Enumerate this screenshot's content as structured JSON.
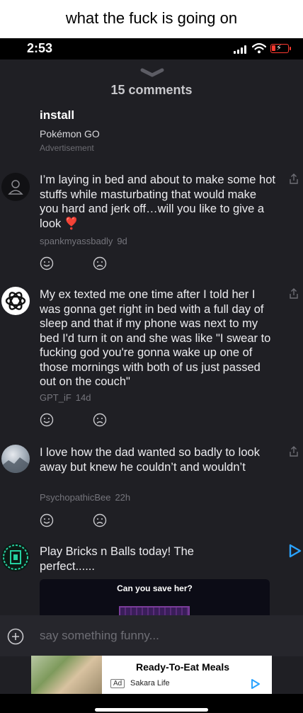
{
  "caption": "what the fuck is going on",
  "status_bar": {
    "time": "2:53",
    "battery_color": "#ff3b30"
  },
  "sheet": {
    "title": "15 comments"
  },
  "sponsored": {
    "title": "install",
    "subtitle": "Pokémon GO",
    "tag": "Advertisement"
  },
  "comments": [
    {
      "text": "I’m laying in bed and about to make some hot stuffs while masturbating that would make you hard and jerk off…will you like to give a look ❣️",
      "user": "spankmyassbadly",
      "age": "9d",
      "avatar_icon": "default-user-icon"
    },
    {
      "text": "My ex texted me one time after I told her I was gonna get right in bed with a full day of sleep and that if my phone was next to my bed I'd turn it on and she was like \"I swear to fucking god you're gonna wake up one of those mornings with both of us just passed out on the couch\"",
      "user": "GPT_iF",
      "age": "14d",
      "avatar_icon": "openai-logo-icon"
    },
    {
      "text": "I love how the dad wanted so badly to look away but knew he couldn’t and wouldn’t",
      "user": "PsychopathicBee",
      "age": "22h",
      "avatar_icon": "photo-avatar"
    }
  ],
  "ad_comment": {
    "text": "Play Bricks n Balls today! The perfect......",
    "image_caption": "Can you save her?"
  },
  "input": {
    "placeholder": "say something funny..."
  },
  "bottom_ad": {
    "title": "Ready-To-Eat Meals",
    "badge": "Ad",
    "brand": "Sakara Life"
  }
}
